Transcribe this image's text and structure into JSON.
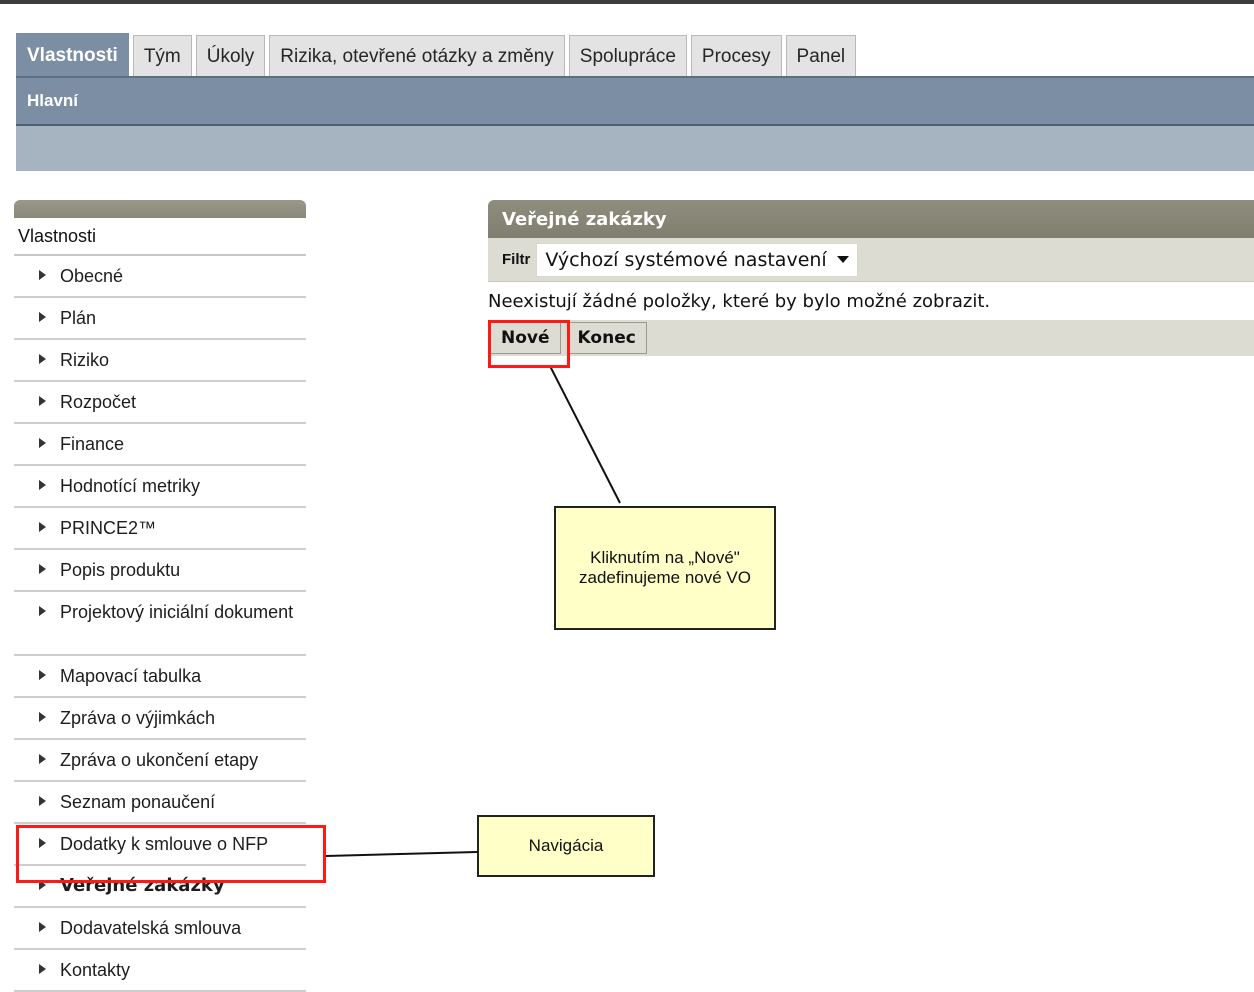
{
  "tabs": [
    {
      "label": "Vlastnosti",
      "active": true
    },
    {
      "label": "Tým"
    },
    {
      "label": "Úkoly"
    },
    {
      "label": "Rizika, otevřené otázky a změny"
    },
    {
      "label": "Spolupráce"
    },
    {
      "label": "Procesy"
    },
    {
      "label": "Panel"
    }
  ],
  "subnav": {
    "label": "Hlavní"
  },
  "sidebar": {
    "title": "Vlastnosti",
    "items": [
      "Obecné",
      "Plán",
      "Riziko",
      "Rozpočet",
      "Finance",
      "Hodnotící metriky",
      "PRINCE2™",
      "Popis produktu",
      "Projektový iniciální dokument",
      "Mapovací tabulka",
      "Zpráva o výjimkách",
      "Zpráva o ukončení etapy",
      "Seznam ponaučení",
      "Dodatky k smlouve o NFP",
      "Veřejné zakázky",
      "Dodavatelská smlouva",
      "Kontakty"
    ],
    "active_index": 14
  },
  "panel": {
    "title": "Veřejné zakázky",
    "filter_label": "Filtr",
    "filter_value": "Výchozí systémové nastavení",
    "empty_message": "Neexistují žádné položky, které by bylo možné zobrazit.",
    "buttons": {
      "new": "Nové",
      "end": "Konec"
    }
  },
  "annotations": {
    "callout_new": "Kliknutím na „Nové\" zadefinujeme nové VO",
    "callout_nav": "Navigácia",
    "highlight_color": "#ff1818",
    "callout_color": "#ffffc8"
  }
}
